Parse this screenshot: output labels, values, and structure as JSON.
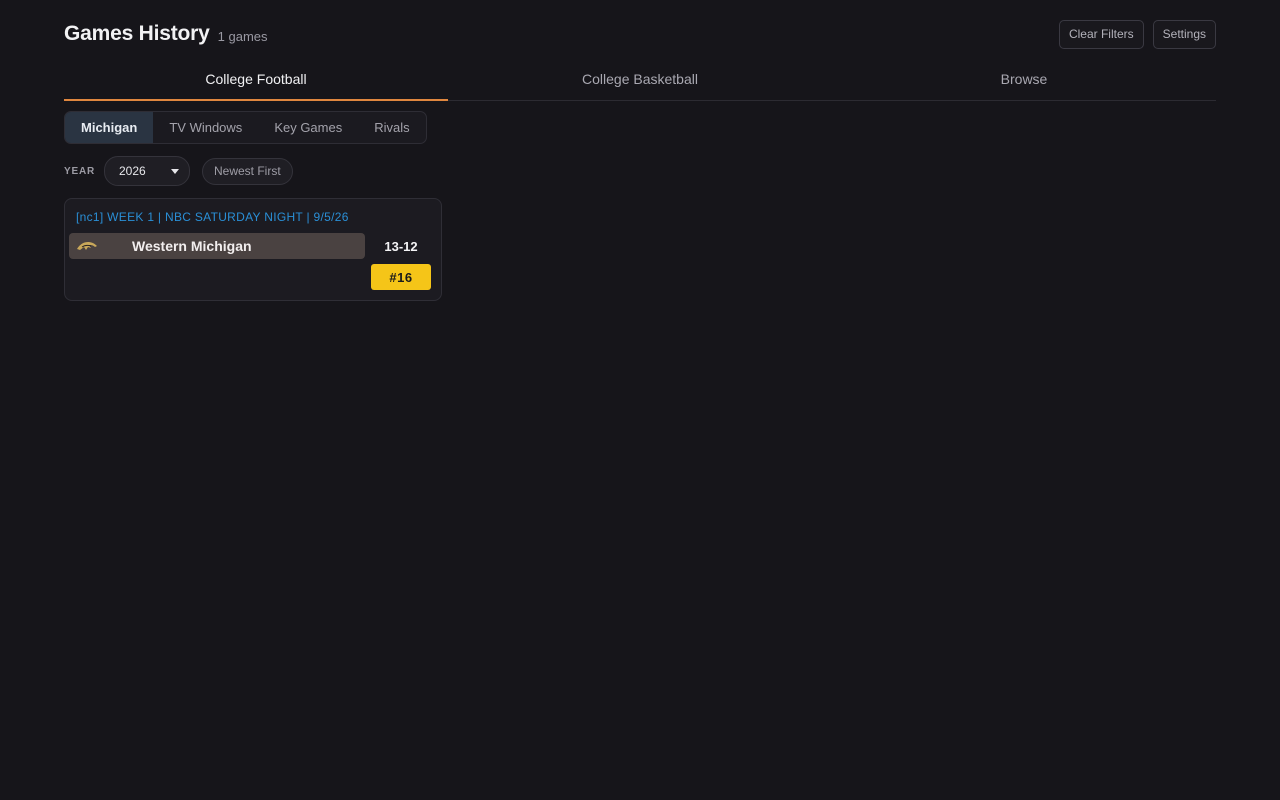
{
  "header": {
    "title": "Games History",
    "count": "1 games",
    "clear_filters_label": "Clear Filters",
    "settings_label": "Settings"
  },
  "sport_tabs": [
    {
      "label": "College Football",
      "active": true
    },
    {
      "label": "College Basketball",
      "active": false
    },
    {
      "label": "Browse",
      "active": false
    }
  ],
  "subtabs": [
    {
      "label": "Michigan",
      "active": true
    },
    {
      "label": "TV Windows",
      "active": false
    },
    {
      "label": "Key Games",
      "active": false
    },
    {
      "label": "Rivals",
      "active": false
    }
  ],
  "filters": {
    "year_label": "YEAR",
    "year_value": "2026",
    "sort_label": "Newest First"
  },
  "games": [
    {
      "meta": "[nc1] WEEK 1 | NBC SATURDAY NIGHT | 9/5/26",
      "team": "Western Michigan",
      "team_logo_icon": "bronco-logo-icon",
      "score": "13-12",
      "rank": "#16"
    }
  ],
  "colors": {
    "background": "#16151a",
    "accent": "#e0873f",
    "meta_text": "#2a8fd6",
    "rank_badge": "#f5c518",
    "team_row": "#4a4241"
  }
}
